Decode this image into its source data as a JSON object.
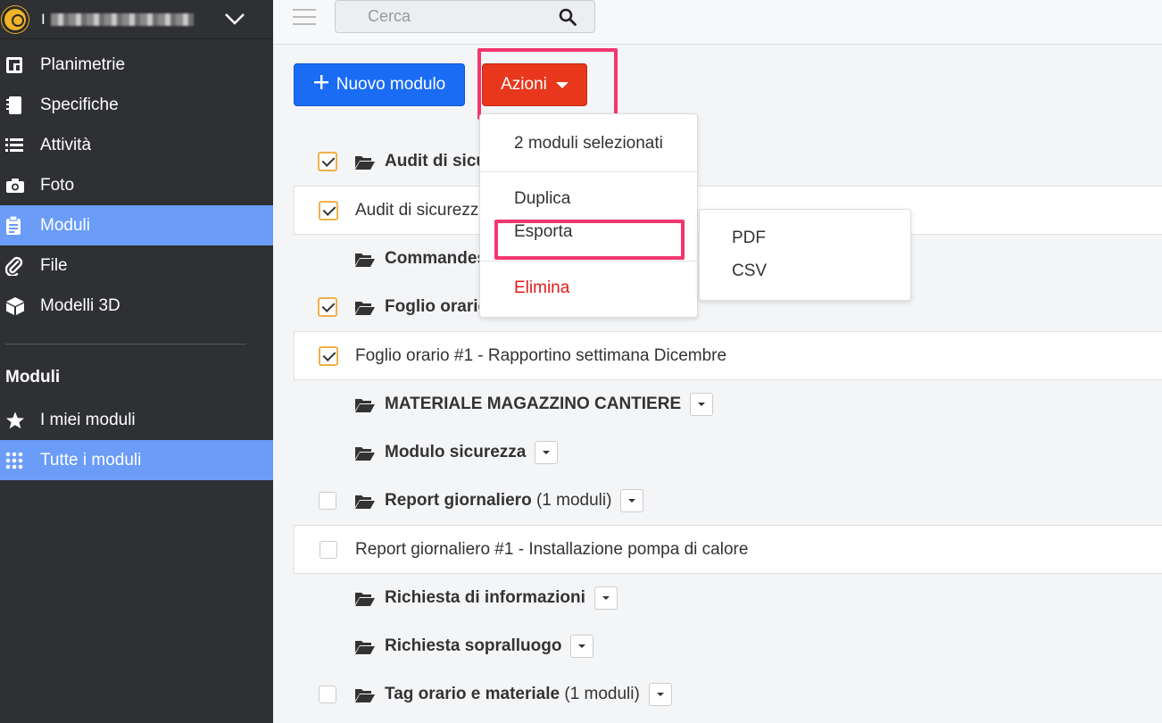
{
  "sidebar": {
    "project_name": "I",
    "items": [
      {
        "label": "Planimetrie",
        "icon": "floorplan-icon"
      },
      {
        "label": "Specifiche",
        "icon": "notebook-icon"
      },
      {
        "label": "Attività",
        "icon": "list-icon"
      },
      {
        "label": "Foto",
        "icon": "camera-icon"
      },
      {
        "label": "Moduli",
        "icon": "clipboard-icon",
        "active": true
      },
      {
        "label": "File",
        "icon": "paperclip-icon"
      },
      {
        "label": "Modelli 3D",
        "icon": "cube-icon"
      }
    ],
    "section_title": "Moduli",
    "section_items": [
      {
        "label": "I miei moduli",
        "icon": "star-icon"
      },
      {
        "label": "Tutte i moduli",
        "icon": "grid-icon",
        "active": true
      }
    ]
  },
  "topbar": {
    "search_placeholder": "Cerca"
  },
  "toolbar": {
    "new_label": "Nuovo modulo",
    "actions_label": "Azioni"
  },
  "dropdown": {
    "selected_info": "2 moduli selezionati",
    "duplicate": "Duplica",
    "export": "Esporta",
    "delete": "Elimina",
    "export_submenu": [
      "PDF",
      "CSV"
    ]
  },
  "list": [
    {
      "type": "folder",
      "name": "Audit di sicu",
      "checked": true
    },
    {
      "type": "item",
      "name": "Audit di sicurezz",
      "checked": true
    },
    {
      "type": "folder",
      "name": "Commandes"
    },
    {
      "type": "folder",
      "name": "Foglio orario",
      "checked": true
    },
    {
      "type": "item",
      "name": "Foglio orario #1 - Rapportino settimana Dicembre",
      "checked": true
    },
    {
      "type": "folder",
      "name": "MATERIALE MAGAZZINO CANTIERE"
    },
    {
      "type": "folder",
      "name": "Modulo sicurezza"
    },
    {
      "type": "folder",
      "name": "Report giornaliero",
      "count": "(1 moduli)",
      "checked": false
    },
    {
      "type": "item",
      "name": "Report giornaliero #1 - Installazione pompa di calore",
      "checked": false
    },
    {
      "type": "folder",
      "name": "Richiesta di informazioni"
    },
    {
      "type": "folder",
      "name": "Richiesta sopralluogo"
    },
    {
      "type": "folder",
      "name": "Tag orario e materiale",
      "count": "(1 moduli)",
      "checked": false
    }
  ],
  "colors": {
    "sidebar_bg": "#2f3033",
    "sidebar_active": "#6a9cf8",
    "primary_button": "#1a6cf5",
    "actions_button": "#e8371d",
    "highlight": "#f2366e",
    "checkbox_border": "#f0b14a",
    "danger_text": "#e21b1b"
  }
}
